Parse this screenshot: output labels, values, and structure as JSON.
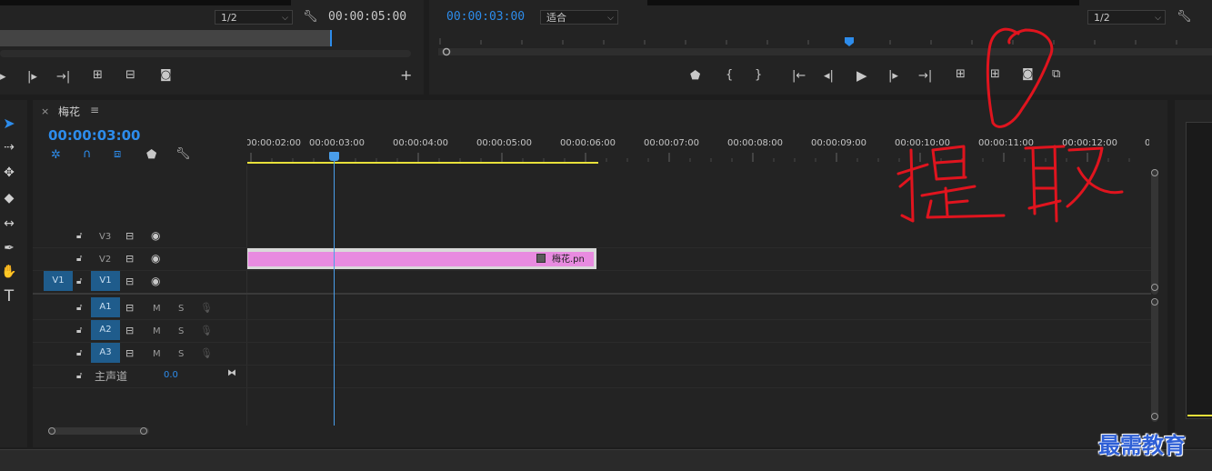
{
  "source_monitor": {
    "zoom": "1/2",
    "duration": "00:00:05:00"
  },
  "program_monitor": {
    "timecode": "00:00:03:00",
    "fit_label": "适合",
    "zoom": "1/2"
  },
  "timeline": {
    "tab_close": "×",
    "tab_title": "梅花",
    "tab_menu": "≡",
    "timecode": "00:00:03:00",
    "ruler": [
      "00:00:02:00",
      "00:00:03:00",
      "00:00:04:00",
      "00:00:05:00",
      "00:00:06:00",
      "00:00:07:00",
      "00:00:08:00",
      "00:00:09:00",
      "00:00:10:00",
      "00:00:11:00",
      "00:00:12:00",
      "0"
    ],
    "tracks": {
      "v3": "V3",
      "v2": "V2",
      "v1": "V1",
      "v1_source": "V1",
      "a1": "A1",
      "a2": "A2",
      "a3": "A3",
      "mute": "M",
      "solo": "S",
      "master_label": "主声道",
      "master_value": "0.0"
    },
    "clip_label": "梅花.pn",
    "clip_color": "#e88be0"
  },
  "annotation": {
    "text": "提取"
  },
  "watermark": "最需教育",
  "colors": {
    "accent_blue": "#2d8ceb",
    "track_blue": "#1f5c8c",
    "playhead": "#4a9eea",
    "work_area": "#e8e03a",
    "annotation_red": "#e0141e"
  }
}
